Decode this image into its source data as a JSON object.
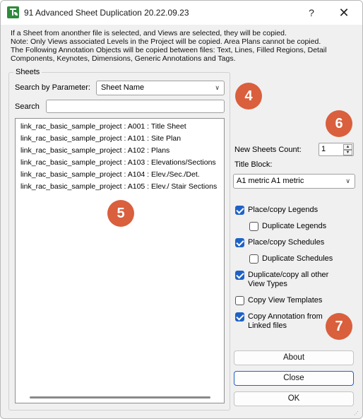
{
  "window": {
    "title": "91 Advanced Sheet Duplication 20.22.09.23",
    "help": "?",
    "close": "✕"
  },
  "info": {
    "lines": [
      "If a Sheet from anonther file is selected, and Views are selected, they will be copied.",
      "Note: Only Views associated Levels in the Project will be copied. Area Plans cannot be copied.",
      "The Following Annotation Objects will be copied between files: Text, Lines, Filled Regions, Detail",
      "Components, Keynotes, Dimensions, Generic Annotations and Tags."
    ]
  },
  "sheets": {
    "group_label": "Sheets",
    "search_by_label": "Search by Parameter:",
    "search_by_value": "Sheet Name",
    "search_label": "Search",
    "search_value": "",
    "items": [
      "link_rac_basic_sample_project : A001 : Title Sheet",
      "link_rac_basic_sample_project : A101 : Site Plan",
      "link_rac_basic_sample_project : A102 : Plans",
      "link_rac_basic_sample_project : A103 : Elevations/Sections",
      "link_rac_basic_sample_project : A104 : Elev./Sec./Det.",
      "link_rac_basic_sample_project : A105 : Elev./ Stair Sections"
    ]
  },
  "options": {
    "new_sheets_label": "New Sheets Count:",
    "new_sheets_value": "1",
    "title_block_label": "Title Block:",
    "title_block_value": "A1 metric A1 metric",
    "checkboxes": {
      "place_legends": "Place/copy Legends",
      "dup_legends": "Duplicate Legends",
      "place_schedules": "Place/copy Schedules",
      "dup_schedules": "Duplicate Schedules",
      "dup_views_1": "Duplicate/copy all other",
      "dup_views_2": "View Types",
      "copy_templates": "Copy View Templates",
      "copy_annotation_1": "Copy  Annotation from",
      "copy_annotation_2": "Linked files"
    }
  },
  "buttons": {
    "about": "About",
    "close": "Close",
    "ok": "OK"
  },
  "badges": {
    "b4": "4",
    "b5": "5",
    "b6": "6",
    "b7": "7",
    "color": "#d95f3d"
  }
}
